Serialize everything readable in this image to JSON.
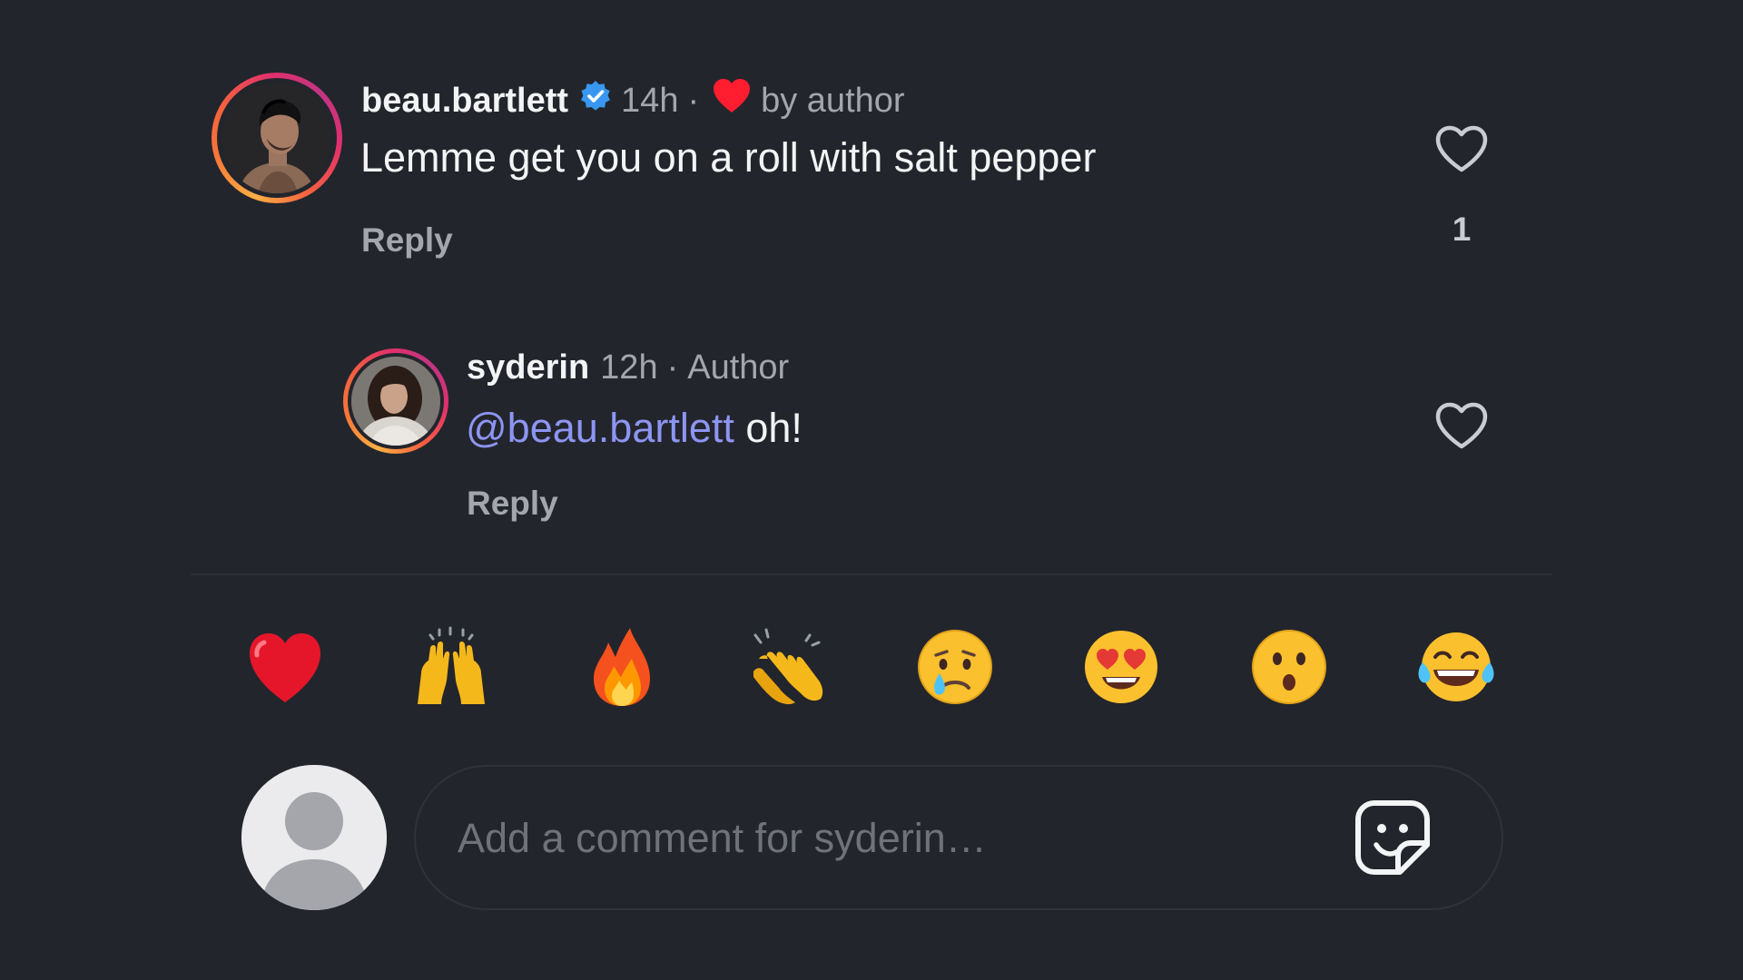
{
  "comments": [
    {
      "username": "beau.bartlett",
      "verified": true,
      "time": "14h",
      "separator": "·",
      "liked_by_label": "by author",
      "text": "Lemme get you on a roll with salt pepper",
      "reply_label": "Reply",
      "like_count": "1"
    }
  ],
  "reply": {
    "username": "syderin",
    "time": "12h",
    "separator": "·",
    "role": "Author",
    "mention": "@beau.bartlett",
    "text": " oh!",
    "reply_label": "Reply"
  },
  "reactions": [
    {
      "name": "red-heart"
    },
    {
      "name": "raising-hands"
    },
    {
      "name": "fire"
    },
    {
      "name": "clapping-hands"
    },
    {
      "name": "crying-face"
    },
    {
      "name": "heart-eyes-face"
    },
    {
      "name": "hushed-face"
    },
    {
      "name": "tears-of-joy-face"
    }
  ],
  "composer": {
    "placeholder": "Add a comment for syderin…",
    "value": ""
  },
  "colors": {
    "background": "#23252c",
    "text": "#f3f4f6",
    "muted": "#a3a6ae",
    "mention": "#8d95f2",
    "verified": "#3897f0",
    "like_heart": "#ff3040"
  }
}
